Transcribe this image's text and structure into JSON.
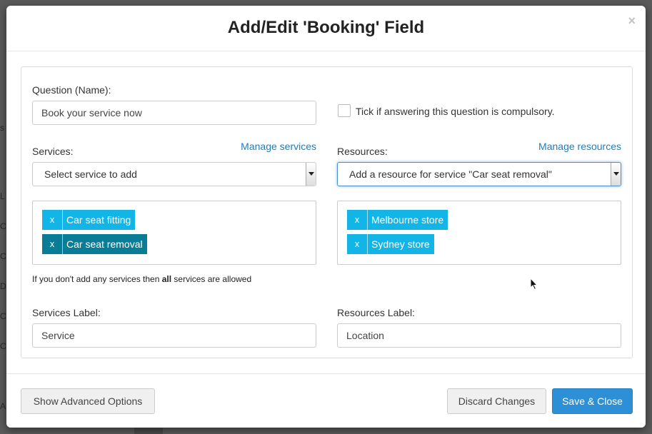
{
  "modal": {
    "title": "Add/Edit 'Booking' Field",
    "close_label": "×"
  },
  "question": {
    "label": "Question (Name):",
    "value": "Book your service now"
  },
  "compulsory": {
    "label": "Tick if answering this question is compulsory.",
    "checked": false
  },
  "services": {
    "label": "Services:",
    "manage_link": "Manage services",
    "select_placeholder": "Select service to add",
    "tags": [
      {
        "remove": "x",
        "label": "Car seat fitting",
        "active": false
      },
      {
        "remove": "x",
        "label": "Car seat removal",
        "active": true
      }
    ],
    "hint_pre": "If you don't add any services then ",
    "hint_bold": "all",
    "hint_post": " services are allowed"
  },
  "resources": {
    "label": "Resources:",
    "manage_link": "Manage resources",
    "select_value": "Add a resource for service \"Car seat removal\"",
    "tags": [
      {
        "remove": "x",
        "label": "Melbourne store"
      },
      {
        "remove": "x",
        "label": "Sydney store"
      }
    ]
  },
  "services_label": {
    "label": "Services Label:",
    "value": "Service"
  },
  "resources_label": {
    "label": "Resources Label:",
    "value": "Location"
  },
  "footer": {
    "advanced_button": "Show Advanced Options",
    "discard_button": "Discard Changes",
    "save_button": "Save & Close"
  },
  "colors": {
    "tag": "#12b5e5",
    "tag_active": "#0a7d96",
    "primary": "#2d8fd5",
    "link": "#1a7fc1"
  }
}
